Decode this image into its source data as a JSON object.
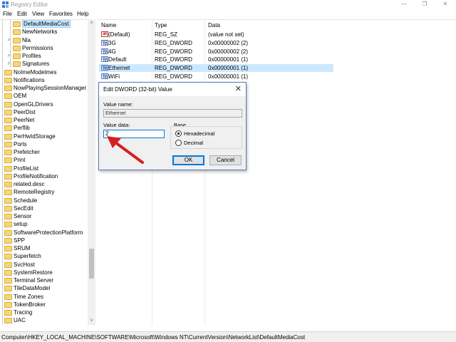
{
  "window": {
    "title": "Registry Editor",
    "minimize_glyph": "—",
    "maximize_glyph": "❐",
    "close_glyph": "✕"
  },
  "menu": [
    "File",
    "Edit",
    "View",
    "Favorites",
    "Help"
  ],
  "tree": {
    "selected": "DefaultMediaCost",
    "items": [
      {
        "label": "DefaultMediaCost",
        "depth": 2,
        "expander": "",
        "selected": true
      },
      {
        "label": "NewNetworks",
        "depth": 2,
        "expander": ""
      },
      {
        "label": "Nla",
        "depth": 2,
        "expander": ">"
      },
      {
        "label": "Permissions",
        "depth": 2,
        "expander": ""
      },
      {
        "label": "Profiles",
        "depth": 2,
        "expander": ">"
      },
      {
        "label": "Signatures",
        "depth": 2,
        "expander": ">"
      },
      {
        "label": "NoImeModelmes",
        "depth": 1,
        "expander": ""
      },
      {
        "label": "Notifications",
        "depth": 1,
        "expander": ""
      },
      {
        "label": "NowPlayingSessionManager",
        "depth": 1,
        "expander": ""
      },
      {
        "label": "OEM",
        "depth": 1,
        "expander": ""
      },
      {
        "label": "OpenGLDrivers",
        "depth": 1,
        "expander": ""
      },
      {
        "label": "PeerDist",
        "depth": 1,
        "expander": ""
      },
      {
        "label": "PeerNet",
        "depth": 1,
        "expander": ""
      },
      {
        "label": "Perflib",
        "depth": 1,
        "expander": ""
      },
      {
        "label": "PerHwIdStorage",
        "depth": 1,
        "expander": ""
      },
      {
        "label": "Ports",
        "depth": 1,
        "expander": ""
      },
      {
        "label": "Prefetcher",
        "depth": 1,
        "expander": ""
      },
      {
        "label": "Print",
        "depth": 1,
        "expander": ""
      },
      {
        "label": "ProfileList",
        "depth": 1,
        "expander": ""
      },
      {
        "label": "ProfileNotification",
        "depth": 1,
        "expander": ""
      },
      {
        "label": "related.desc",
        "depth": 1,
        "expander": ""
      },
      {
        "label": "RemoteRegistry",
        "depth": 1,
        "expander": ""
      },
      {
        "label": "Schedule",
        "depth": 1,
        "expander": ""
      },
      {
        "label": "SecEdit",
        "depth": 1,
        "expander": ""
      },
      {
        "label": "Sensor",
        "depth": 1,
        "expander": ""
      },
      {
        "label": "setup",
        "depth": 1,
        "expander": ""
      },
      {
        "label": "SoftwareProtectionPlatform",
        "depth": 1,
        "expander": ""
      },
      {
        "label": "SPP",
        "depth": 1,
        "expander": ""
      },
      {
        "label": "SRUM",
        "depth": 1,
        "expander": ""
      },
      {
        "label": "Superfetch",
        "depth": 1,
        "expander": ""
      },
      {
        "label": "SvcHost",
        "depth": 1,
        "expander": ""
      },
      {
        "label": "SystemRestore",
        "depth": 1,
        "expander": ""
      },
      {
        "label": "Terminal Server",
        "depth": 1,
        "expander": ""
      },
      {
        "label": "TileDataModel",
        "depth": 1,
        "expander": ""
      },
      {
        "label": "Time Zones",
        "depth": 1,
        "expander": ""
      },
      {
        "label": "TokenBroker",
        "depth": 1,
        "expander": ""
      },
      {
        "label": "Tracing",
        "depth": 1,
        "expander": ""
      },
      {
        "label": "UAC",
        "depth": 1,
        "expander": ""
      }
    ]
  },
  "scrollbar": {
    "up": "˄",
    "down": "˅"
  },
  "list": {
    "columns": [
      "Name",
      "Type",
      "Data"
    ],
    "rows": [
      {
        "icon": "string-value-icon",
        "icon_text": "ab",
        "name": "(Default)",
        "type": "REG_SZ",
        "data": "(value not set)"
      },
      {
        "icon": "dword-value-icon",
        "icon_text": "011 110",
        "name": "3G",
        "type": "REG_DWORD",
        "data": "0x00000002 (2)"
      },
      {
        "icon": "dword-value-icon",
        "icon_text": "011 110",
        "name": "4G",
        "type": "REG_DWORD",
        "data": "0x00000002 (2)"
      },
      {
        "icon": "dword-value-icon",
        "icon_text": "011 110",
        "name": "Default",
        "type": "REG_DWORD",
        "data": "0x00000001 (1)"
      },
      {
        "icon": "dword-value-icon",
        "icon_text": "011 110",
        "name": "Ethernet",
        "type": "REG_DWORD",
        "data": "0x00000001 (1)",
        "selected": true
      },
      {
        "icon": "dword-value-icon",
        "icon_text": "011 110",
        "name": "WiFi",
        "type": "REG_DWORD",
        "data": "0x00000001 (1)"
      }
    ]
  },
  "dialog": {
    "title": "Edit DWORD (32-bit) Value",
    "close_glyph": "✕",
    "value_name_label": "Value name:",
    "value_name": "Ethernet",
    "value_data_label": "Value data:",
    "value_data": "2",
    "base_label": "Base",
    "hex_label": "Hexadecimal",
    "dec_label": "Decimal",
    "base_selected": "Hexadecimal",
    "ok_label": "OK",
    "cancel_label": "Cancel"
  },
  "annotation": {
    "arrow_color": "#d42020"
  },
  "status_path": "Computer\\HKEY_LOCAL_MACHINE\\SOFTWARE\\Microsoft\\Windows NT\\CurrentVersion\\NetworkList\\DefaultMediaCost"
}
